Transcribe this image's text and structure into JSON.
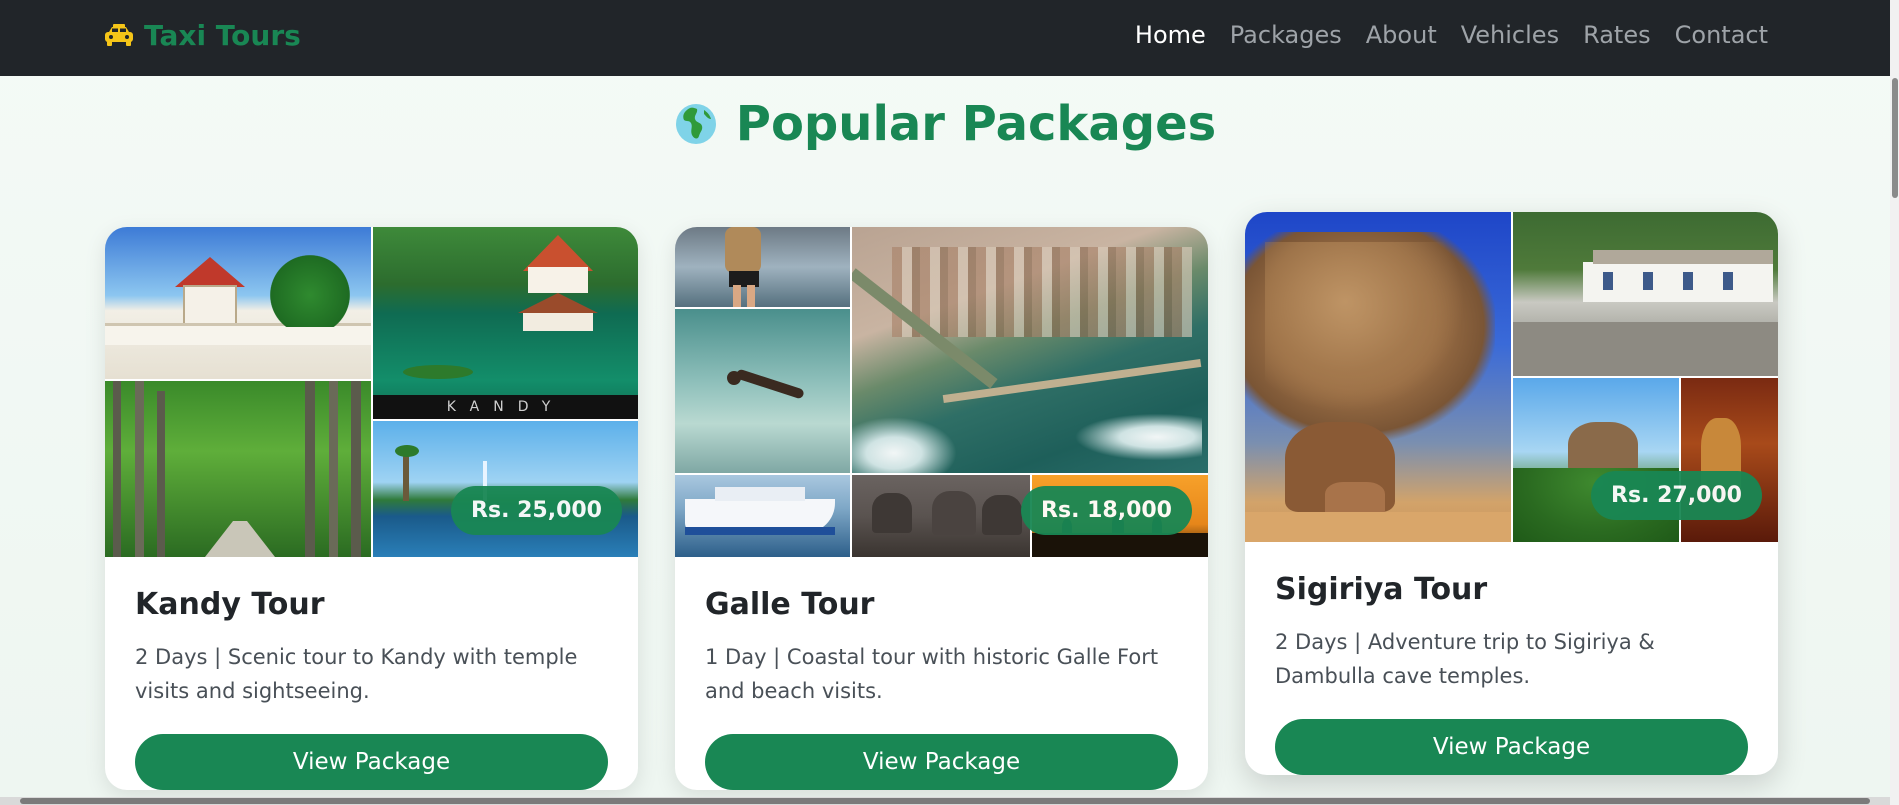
{
  "navbar": {
    "brand": "Taxi Tours",
    "links": [
      {
        "label": "Home",
        "active": true
      },
      {
        "label": "Packages",
        "active": false
      },
      {
        "label": "About",
        "active": false
      },
      {
        "label": "Vehicles",
        "active": false
      },
      {
        "label": "Rates",
        "active": false
      },
      {
        "label": "Contact",
        "active": false
      }
    ]
  },
  "section": {
    "title": "Popular Packages"
  },
  "packages": [
    {
      "title": "Kandy Tour",
      "description": "2 Days | Scenic tour to Kandy with temple visits and sightseeing.",
      "price": "Rs. 25,000",
      "image_caption": "KANDY",
      "button": "View Package"
    },
    {
      "title": "Galle Tour",
      "description": "1 Day | Coastal tour with historic Galle Fort and beach visits.",
      "price": "Rs. 18,000",
      "button": "View Package"
    },
    {
      "title": "Sigiriya Tour",
      "description": "2 Days | Adventure trip to Sigiriya & Dambulla cave temples.",
      "price": "Rs. 27,000",
      "button": "View Package"
    }
  ],
  "colors": {
    "brand_green": "#198754",
    "navbar_bg": "#212529",
    "taxi_yellow": "#f5c518"
  }
}
